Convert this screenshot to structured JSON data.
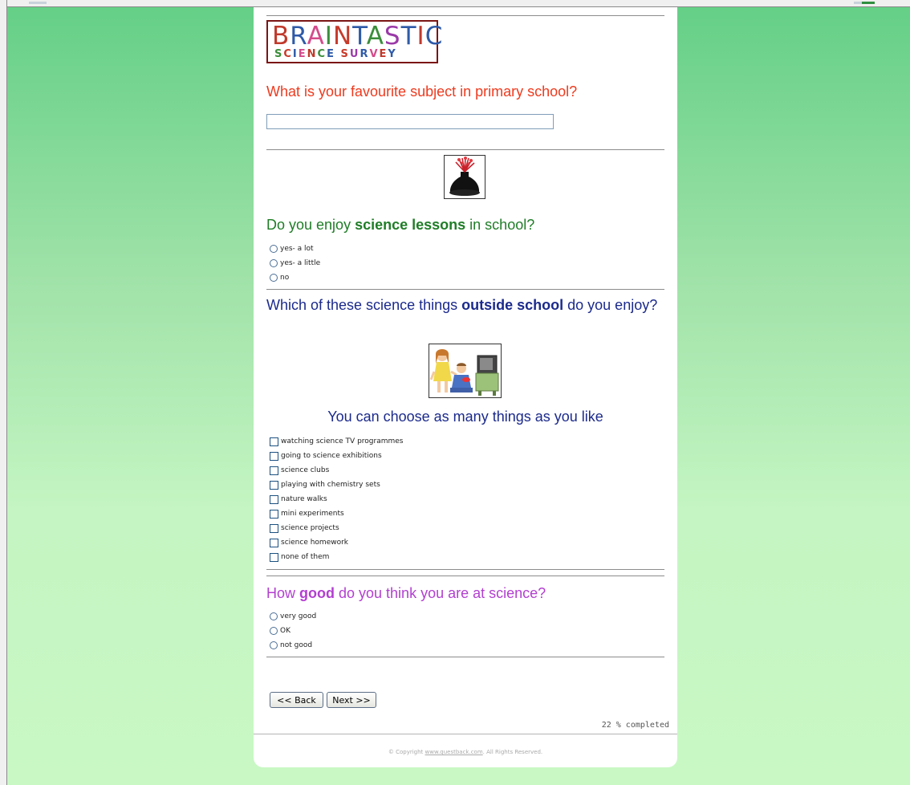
{
  "logo": {
    "line1": "BRAINTASTIC",
    "line2": "SCIENCE SURVEY",
    "line1_colors": [
      "#c0392b",
      "#2e5aa8",
      "#d44b8c",
      "#3a8d3a",
      "#c73a2a",
      "#2e5aa8",
      "#3a8d3a",
      "#9a3aa8",
      "#2e5aa8",
      "#c0392b",
      "#2e5aa8"
    ],
    "line2_colors": [
      "#3a8d3a",
      "#c73a2a",
      "#2e5aa8",
      "#d44b8c",
      "#c0392b",
      "#3a8d3a",
      "#2e5aa8",
      "#c73a2a",
      "#9a3aa8",
      "#2e5aa8",
      "#d44b8c",
      "#c0392b",
      "#2e5aa8",
      "#3a8d3a"
    ]
  },
  "q1": {
    "text": "What is your favourite subject in primary school?",
    "input_value": ""
  },
  "q2": {
    "pre": "Do you enjoy ",
    "bold": "science lessons",
    "post": " in school?",
    "options": [
      "yes- a lot",
      "yes- a little",
      "no"
    ]
  },
  "q3": {
    "pre": "Which of these science things ",
    "bold": "outside school",
    "post": " do you enjoy?",
    "note": "You can choose as many things as you like",
    "options": [
      "watching science TV programmes",
      "going to science exhibitions",
      "science clubs",
      "playing with chemistry sets",
      "nature walks",
      "mini experiments",
      "science projects",
      "science homework",
      "none of them"
    ]
  },
  "q4": {
    "pre": "How ",
    "bold": "good",
    "post": " do you think you are at science?",
    "options": [
      "very good",
      "OK",
      "not good"
    ]
  },
  "nav": {
    "back": "<< Back",
    "next": "Next >>"
  },
  "progress": "22 % completed",
  "footer": {
    "pre": "© Copyright ",
    "link": "www.questback.com",
    "post": ". All Rights Reserved."
  },
  "icons": {
    "volcano": "volcano-image",
    "kids": "kids-watching-tv-image"
  }
}
